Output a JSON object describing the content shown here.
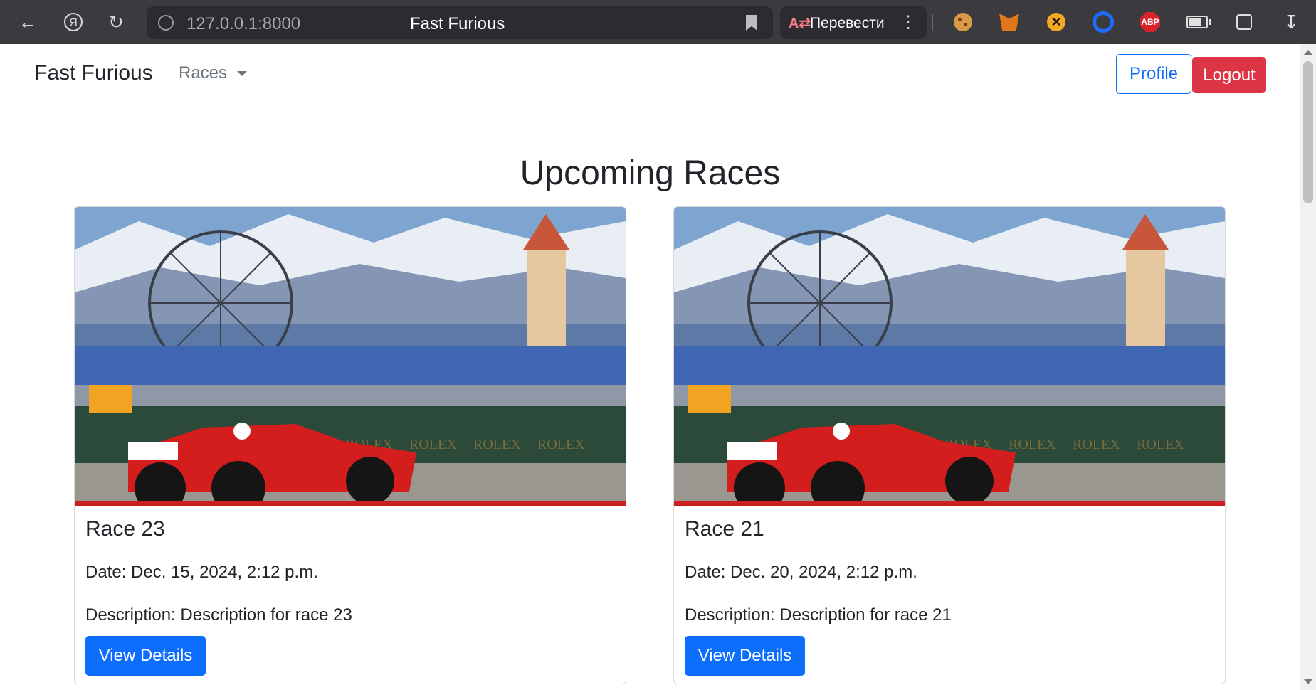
{
  "browser": {
    "url": "127.0.0.1:8000",
    "tab_title": "Fast Furious",
    "translate_label": "Перевести",
    "extensions": [
      "cookie-icon",
      "metamask-fox-icon",
      "x-circle-icon",
      "blue-ring-icon",
      "adblock-plus-icon",
      "battery-icon",
      "puzzle-icon",
      "download-icon"
    ]
  },
  "navbar": {
    "brand": "Fast Furious",
    "races_menu": "Races",
    "profile_label": "Profile",
    "logout_label": "Logout"
  },
  "main": {
    "title": "Upcoming Races",
    "cards": [
      {
        "title": "Race 23",
        "date": "Date: Dec. 15, 2024, 2:12 p.m.",
        "description": "Description: Description for race 23",
        "button": "View Details"
      },
      {
        "title": "Race 21",
        "date": "Date: Dec. 20, 2024, 2:12 p.m.",
        "description": "Description: Description for race 21",
        "button": "View Details"
      }
    ]
  },
  "colors": {
    "primary": "#0d6efd",
    "danger": "#dc3545",
    "chrome": "#3b3b3f"
  }
}
